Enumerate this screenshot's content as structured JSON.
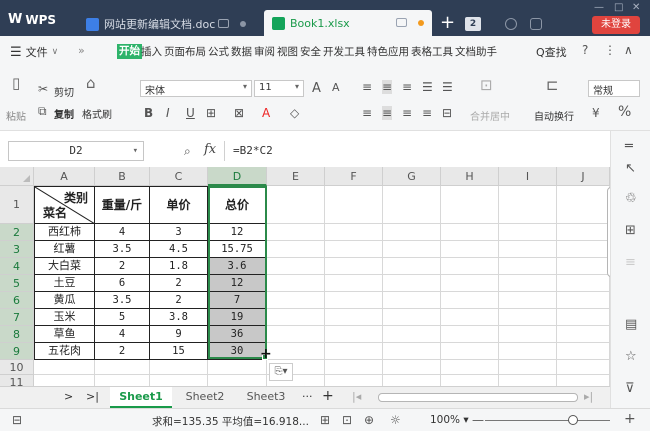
{
  "titlebar": {
    "app": "WPS",
    "tabs": [
      {
        "label": "网站更新编辑文档.doc"
      },
      {
        "label": "Book1.xlsx"
      }
    ],
    "badge": "2",
    "login": "未登录"
  },
  "menubar": {
    "file": "文件",
    "more": "»",
    "start": "开始",
    "items": [
      "插入",
      "页面布局",
      "公式",
      "数据",
      "审阅",
      "视图",
      "安全",
      "开发工具",
      "特色应用",
      "表格工具",
      "文档助手"
    ],
    "search": "Q查找"
  },
  "ribbon": {
    "cut": "剪切",
    "paste": "粘贴",
    "copy": "复制",
    "format_painter": "格式刷",
    "font_name": "宋体",
    "font_size": "11",
    "merge": "合并居中",
    "wrap": "自动换行",
    "number_format": "常规"
  },
  "formula": {
    "name_box": "D2",
    "fx": "fx",
    "value": "=B2*C2"
  },
  "grid": {
    "columns": [
      "A",
      "B",
      "C",
      "D",
      "E",
      "F",
      "G",
      "H",
      "I",
      "J"
    ],
    "rows": [
      "1",
      "2",
      "3",
      "4",
      "5",
      "6",
      "7",
      "8",
      "9",
      "10",
      "11"
    ],
    "header": {
      "a_top": "类别",
      "a_bottom": "菜名",
      "b": "重量/斤",
      "c": "单价",
      "d": "总价"
    },
    "data": [
      [
        "西红柿",
        "4",
        "3",
        "12"
      ],
      [
        "红薯",
        "3.5",
        "4.5",
        "15.75"
      ],
      [
        "大白菜",
        "2",
        "1.8",
        "3.6"
      ],
      [
        "土豆",
        "6",
        "2",
        "12"
      ],
      [
        "黄瓜",
        "3.5",
        "2",
        "7"
      ],
      [
        "玉米",
        "5",
        "3.8",
        "19"
      ],
      [
        "草鱼",
        "4",
        "9",
        "36"
      ],
      [
        "五花肉",
        "2",
        "15",
        "30"
      ]
    ]
  },
  "sheets": [
    "Sheet1",
    "Sheet2",
    "Sheet3"
  ],
  "status": {
    "summary": "求和=135.35  平均值=16.918...",
    "zoom": "100%"
  }
}
